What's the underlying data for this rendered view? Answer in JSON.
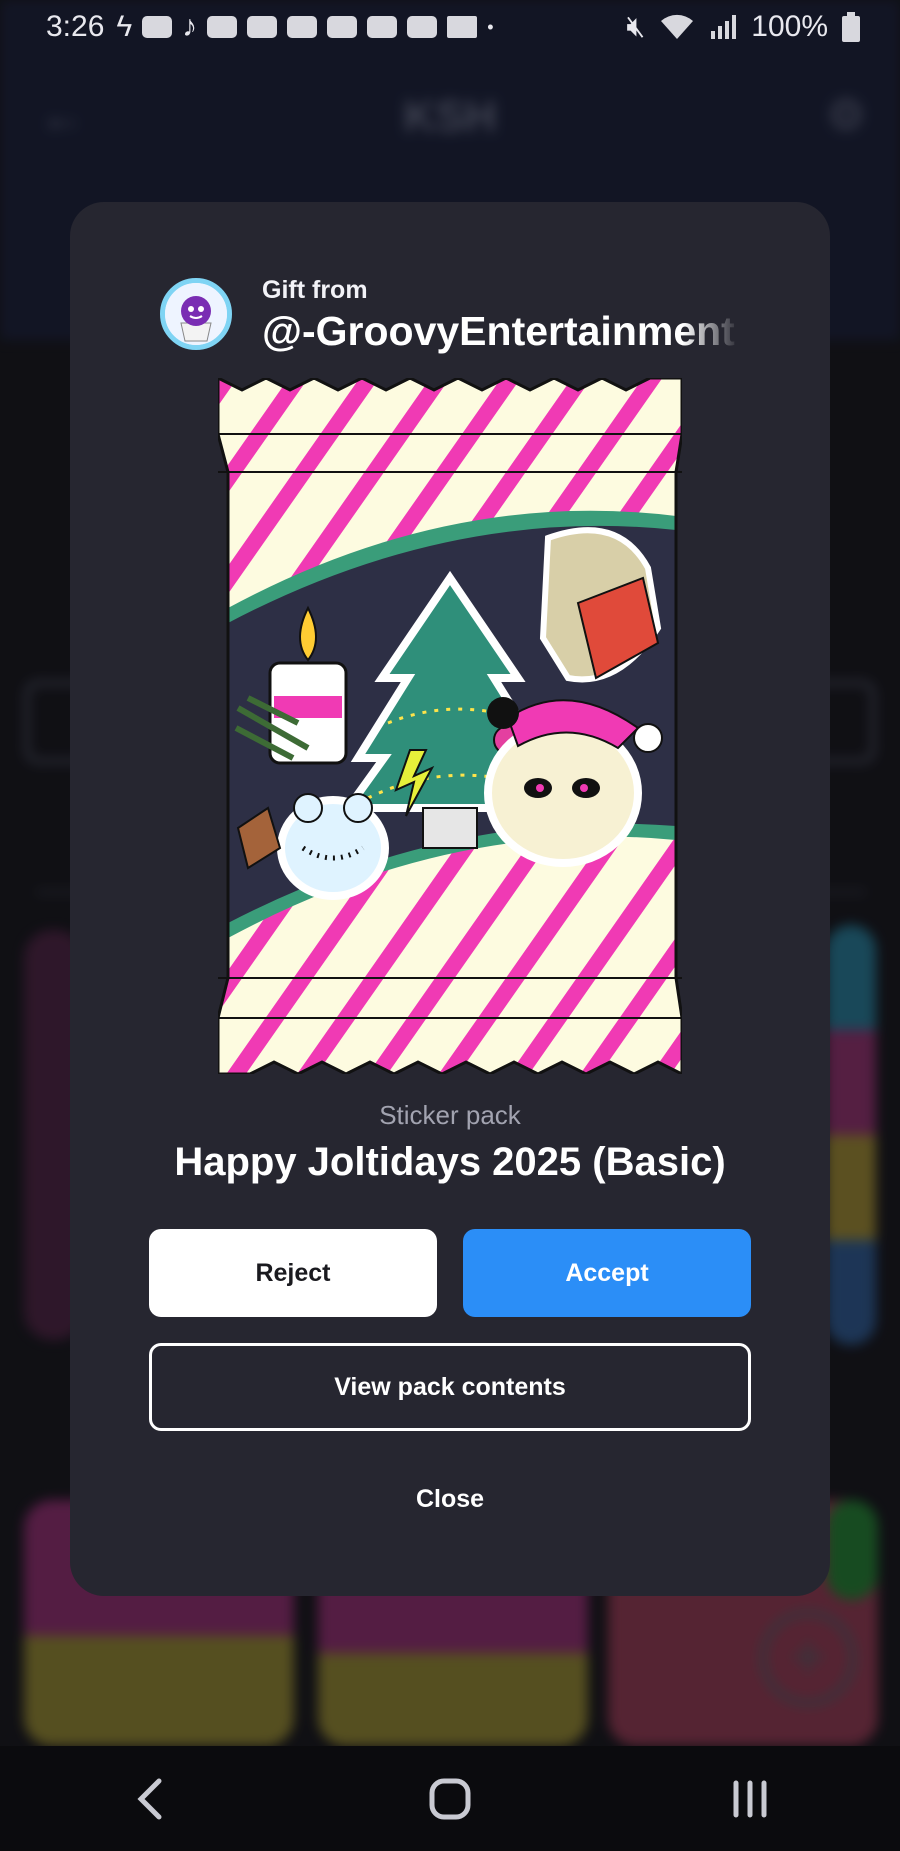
{
  "status_bar": {
    "time": "3:26",
    "battery": "100%"
  },
  "background": {
    "title": "KSH"
  },
  "gift": {
    "label": "Gift from",
    "username": "@-GroovyEntertainment"
  },
  "pack": {
    "type": "Sticker pack",
    "name": "Happy Joltidays 2025 (Basic)"
  },
  "buttons": {
    "reject": "Reject",
    "accept": "Accept",
    "view_contents": "View pack contents",
    "close": "Close"
  },
  "colors": {
    "accent": "#2b8ef7",
    "modal": "#262630",
    "stripe": "#f03ab4",
    "wrapper": "#fdfbe0",
    "band": "#3a9d7a"
  },
  "icons": {
    "back": "back-arrow-icon",
    "settings": "gear-icon",
    "nav_back": "chevron-left-icon",
    "nav_home": "home-icon",
    "nav_recents": "recents-icon"
  }
}
